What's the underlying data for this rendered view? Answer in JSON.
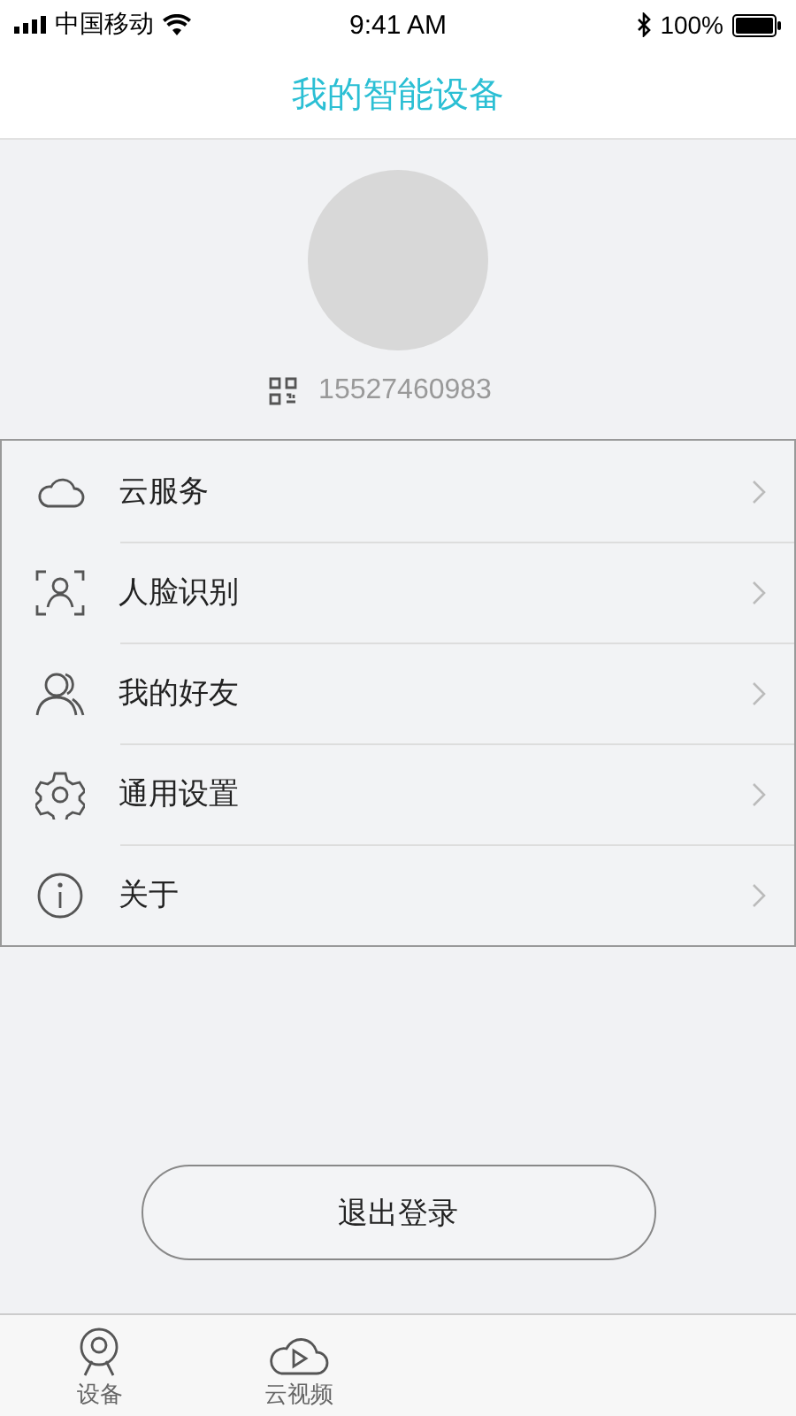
{
  "status_bar": {
    "carrier": "中国移动",
    "time": "9:41 AM",
    "battery": "100%"
  },
  "nav_bar": {
    "title": "我的智能设备"
  },
  "profile": {
    "account": "15527460983"
  },
  "menu": [
    {
      "kind": "cloud",
      "label": "云服务"
    },
    {
      "kind": "face",
      "label": "人脸识别"
    },
    {
      "kind": "friends",
      "label": "我的好友"
    },
    {
      "kind": "settings",
      "label": "通用设置"
    },
    {
      "kind": "info",
      "label": "关于"
    }
  ],
  "logout_button": "退出登录",
  "tab_bar": [
    {
      "kind": "camera",
      "label": "设备"
    },
    {
      "kind": "cloud-video",
      "label": "云视频"
    }
  ]
}
